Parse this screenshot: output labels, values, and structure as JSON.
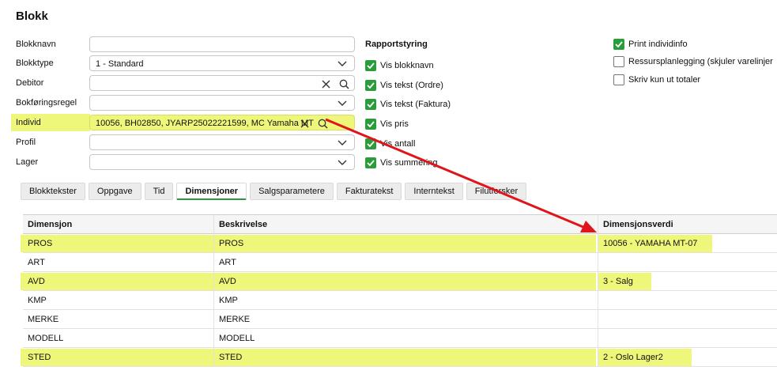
{
  "page": {
    "title": "Blokk"
  },
  "form": {
    "blokknavn": {
      "label": "Blokknavn",
      "value": ""
    },
    "blokktype": {
      "label": "Blokktype",
      "value": "1 - Standard"
    },
    "debitor": {
      "label": "Debitor",
      "value": ""
    },
    "bokforingsregel": {
      "label": "Bokføringsregel",
      "value": ""
    },
    "individ": {
      "label": "Individ",
      "value": "10056, BH02850, JYARP25022221599, MC Yamaha MT"
    },
    "profil": {
      "label": "Profil",
      "value": ""
    },
    "lager": {
      "label": "Lager",
      "value": ""
    }
  },
  "rapportstyring": {
    "title": "Rapportstyring",
    "items": [
      {
        "label": "Vis blokknavn",
        "checked": true
      },
      {
        "label": "Vis tekst (Ordre)",
        "checked": true
      },
      {
        "label": "Vis tekst (Faktura)",
        "checked": true
      },
      {
        "label": "Vis pris",
        "checked": true
      },
      {
        "label": "Vis antall",
        "checked": true
      },
      {
        "label": "Vis summering",
        "checked": true
      }
    ]
  },
  "options": {
    "items": [
      {
        "label": "Print individinfo",
        "checked": true
      },
      {
        "label": "Ressursplanlegging (skjuler varelinjer",
        "checked": false
      },
      {
        "label": "Skriv kun ut totaler",
        "checked": false
      }
    ]
  },
  "tabs": [
    {
      "label": "Blokktekster",
      "active": false
    },
    {
      "label": "Oppgave",
      "active": false
    },
    {
      "label": "Tid",
      "active": false
    },
    {
      "label": "Dimensjoner",
      "active": true
    },
    {
      "label": "Salgsparametere",
      "active": false
    },
    {
      "label": "Fakturatekst",
      "active": false
    },
    {
      "label": "Interntekst",
      "active": false
    },
    {
      "label": "Filutforsker",
      "active": false
    }
  ],
  "grid": {
    "headers": [
      "Dimensjon",
      "Beskrivelse",
      "Dimensjonsverdi"
    ],
    "rows": [
      {
        "dimensjon": "PROS",
        "beskrivelse": "PROS",
        "verdi": "10056 - YAMAHA MT-07",
        "highlighted": true
      },
      {
        "dimensjon": "ART",
        "beskrivelse": "ART",
        "verdi": "",
        "highlighted": false
      },
      {
        "dimensjon": "AVD",
        "beskrivelse": "AVD",
        "verdi": "3 - Salg",
        "highlighted": true
      },
      {
        "dimensjon": "KMP",
        "beskrivelse": "KMP",
        "verdi": "",
        "highlighted": false
      },
      {
        "dimensjon": "MERKE",
        "beskrivelse": "MERKE",
        "verdi": "",
        "highlighted": false
      },
      {
        "dimensjon": "MODELL",
        "beskrivelse": "MODELL",
        "verdi": "",
        "highlighted": false
      },
      {
        "dimensjon": "STED",
        "beskrivelse": "STED",
        "verdi": "2 - Oslo Lager2",
        "highlighted": true
      }
    ]
  },
  "colors": {
    "highlight": "#eef779",
    "check_green": "#2a9d3a",
    "arrow_red": "#e0141b"
  }
}
